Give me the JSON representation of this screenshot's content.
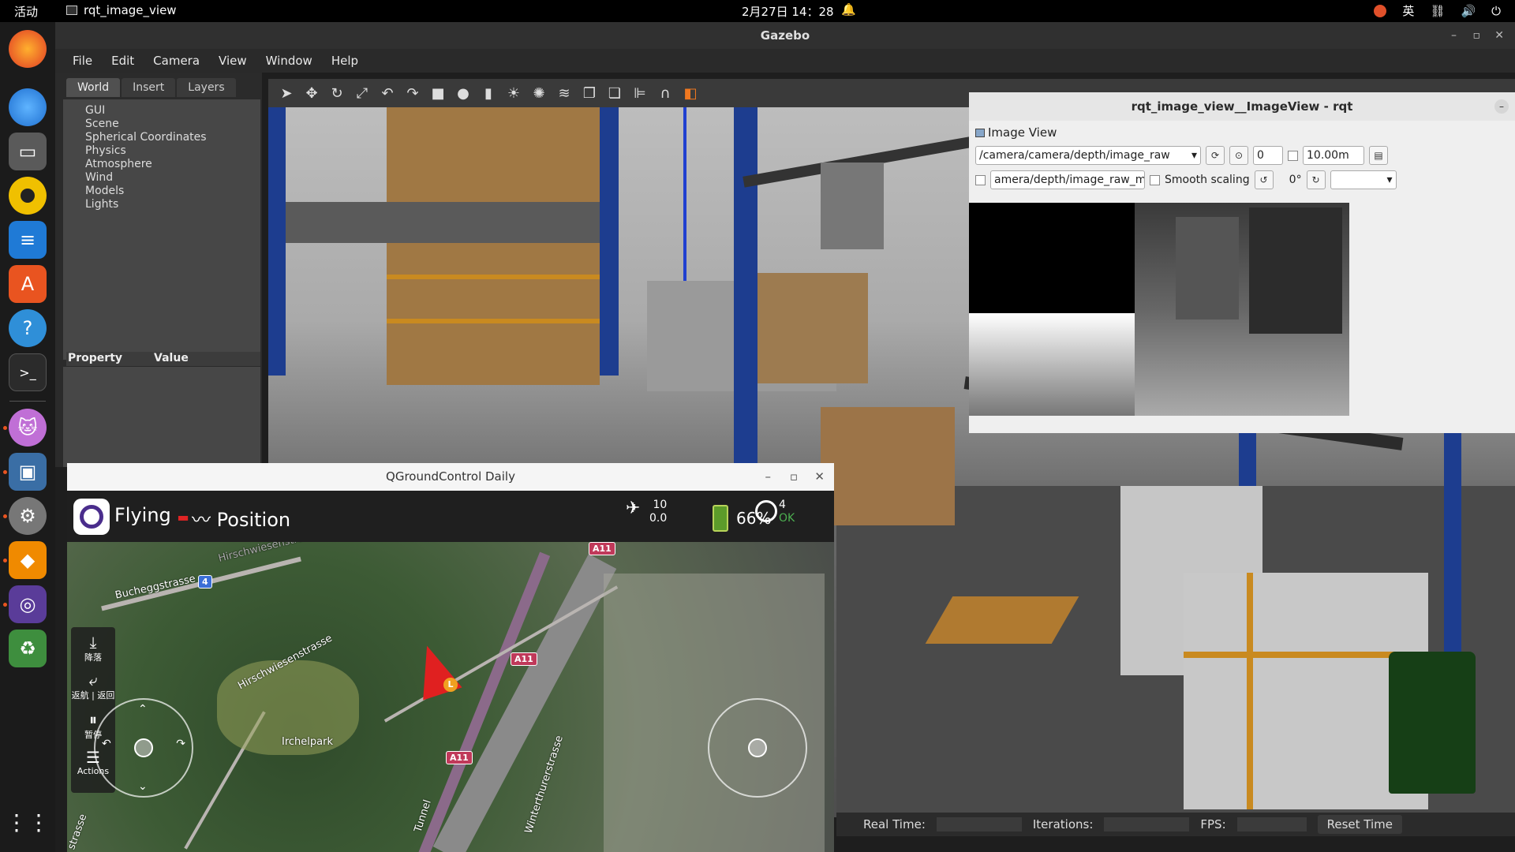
{
  "topbar": {
    "activities": "活动",
    "app_name": "rqt_image_view",
    "clock": "2月27日 14：28",
    "input_method": "英"
  },
  "gazebo": {
    "title": "Gazebo",
    "menu": [
      "File",
      "Edit",
      "Camera",
      "View",
      "Window",
      "Help"
    ],
    "tabs": [
      "World",
      "Insert",
      "Layers"
    ],
    "tree_items": [
      "GUI",
      "Scene",
      "Spherical Coordinates",
      "Physics",
      "Atmosphere",
      "Wind",
      "Models",
      "Lights"
    ],
    "property_header": "Property",
    "value_header": "Value",
    "status": {
      "real_time_label": "Real Time:",
      "iterations_label": "Iterations:",
      "fps_label": "FPS:",
      "reset_button": "Reset Time"
    }
  },
  "rqt": {
    "title": "rqt_image_view__ImageView - rqt",
    "plugin_label": "Image View",
    "topic": "/camera/camera/depth/image_raw",
    "min_value": "0",
    "max_value": "10.00m",
    "publish_topic": "amera/depth/image_raw_mo",
    "smooth_scaling": "Smooth scaling",
    "rotation": "0°"
  },
  "qgc": {
    "title": "QGroundControl Daily",
    "flight_state": "Flying",
    "flight_mode": "Position",
    "satellites": "10",
    "hdop": "0.0",
    "battery": "66%",
    "compass_count": "4",
    "compass_status": "OK",
    "tools": [
      {
        "icon": "land-icon",
        "label": "降落"
      },
      {
        "icon": "return-icon",
        "label": "返航 | 返回"
      },
      {
        "icon": "pause-icon",
        "label": "暂停"
      },
      {
        "icon": "menu-icon",
        "label": "Actions"
      }
    ],
    "map_labels": {
      "bucheggstrasse": "Bucheggstrasse",
      "hirschwiesenstrasse": "Hirschwiesenstrasse",
      "irchelpark": "Irchelpark",
      "winterthurerstrasse": "Winterthurerstrasse",
      "tunnel": "Tunnel",
      "strasse": "strasse",
      "a11": "A11",
      "route4": "4",
      "hirschwiesen_top": "Hirschwiesenstrasse",
      "vehicle_marker": "L"
    }
  }
}
